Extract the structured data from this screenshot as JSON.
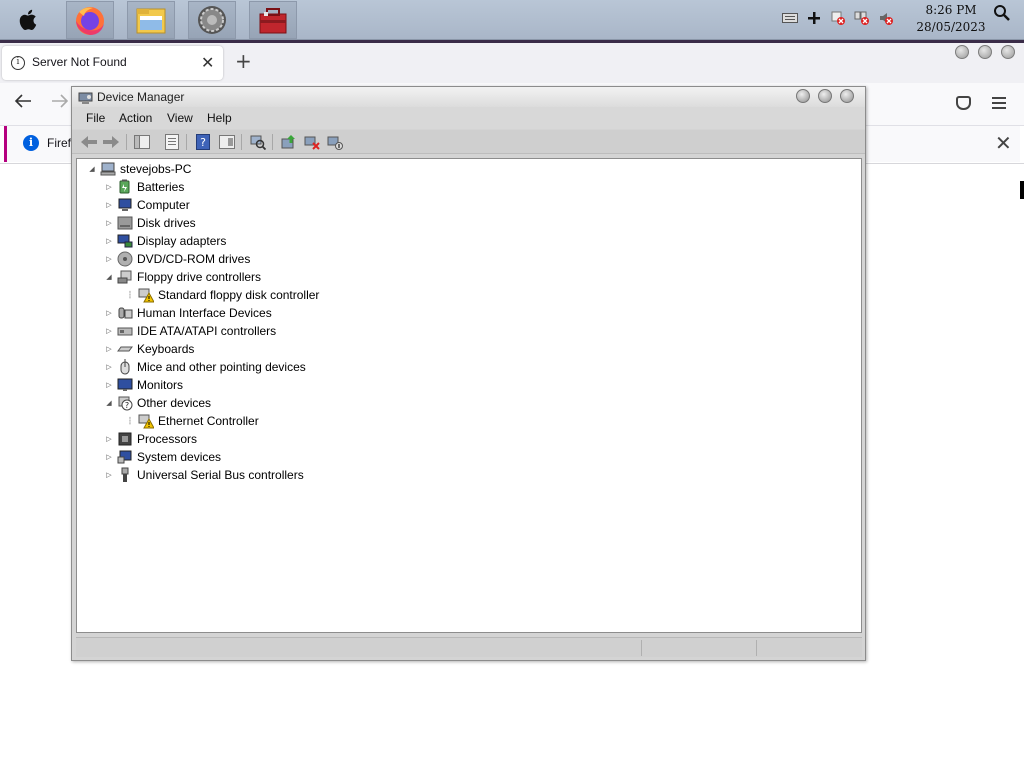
{
  "topbar": {
    "time": "8:26 PM",
    "date": "28/05/2023",
    "dock_apps": [
      "apple-menu",
      "firefox",
      "file-manager",
      "system-settings",
      "toolbox"
    ]
  },
  "firefox": {
    "tab_title": "Server Not Found",
    "infobar_text": "Firefo"
  },
  "device_manager": {
    "title": "Device Manager",
    "menu": [
      "File",
      "Action",
      "View",
      "Help"
    ],
    "root": "stevejobs-PC",
    "categories": [
      {
        "label": "Batteries",
        "icon": "battery-icon",
        "expanded": false
      },
      {
        "label": "Computer",
        "icon": "computer-icon",
        "expanded": false
      },
      {
        "label": "Disk drives",
        "icon": "disk-drive-icon",
        "expanded": false
      },
      {
        "label": "Display adapters",
        "icon": "display-adapter-icon",
        "expanded": false
      },
      {
        "label": "DVD/CD-ROM drives",
        "icon": "dvd-drive-icon",
        "expanded": false
      },
      {
        "label": "Floppy drive controllers",
        "icon": "floppy-controller-icon",
        "expanded": true,
        "children": [
          {
            "label": "Standard floppy disk controller",
            "icon": "floppy-controller-warning-icon",
            "warning": true
          }
        ]
      },
      {
        "label": "Human Interface Devices",
        "icon": "hid-icon",
        "expanded": false
      },
      {
        "label": "IDE ATA/ATAPI controllers",
        "icon": "ide-controller-icon",
        "expanded": false
      },
      {
        "label": "Keyboards",
        "icon": "keyboard-icon",
        "expanded": false
      },
      {
        "label": "Mice and other pointing devices",
        "icon": "mouse-icon",
        "expanded": false
      },
      {
        "label": "Monitors",
        "icon": "monitor-icon",
        "expanded": false
      },
      {
        "label": "Other devices",
        "icon": "unknown-device-icon",
        "expanded": true,
        "children": [
          {
            "label": "Ethernet Controller",
            "icon": "ethernet-warning-icon",
            "warning": true
          }
        ]
      },
      {
        "label": "Processors",
        "icon": "processor-icon",
        "expanded": false
      },
      {
        "label": "System devices",
        "icon": "system-device-icon",
        "expanded": false
      },
      {
        "label": "Universal Serial Bus controllers",
        "icon": "usb-icon",
        "expanded": false
      }
    ]
  },
  "colors": {
    "dock_bg": "#b1bfd0",
    "warning_yellow": "#f2c400",
    "firefox_info_blue": "#0060df",
    "infobar_accent": "#b5007f"
  }
}
